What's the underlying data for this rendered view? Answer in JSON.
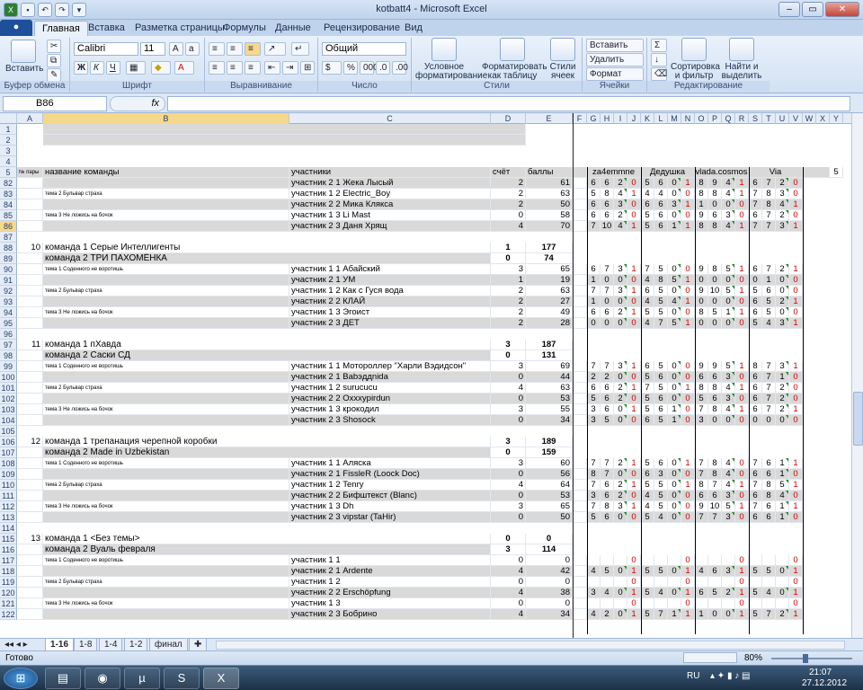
{
  "window": {
    "title": "kotbatt4 - Microsoft Excel"
  },
  "ribbon": {
    "tabs": [
      "Главная",
      "Вставка",
      "Разметка страницы",
      "Формулы",
      "Данные",
      "Рецензирование",
      "Вид"
    ],
    "paste": "Вставить",
    "clipboard": "Буфер обмена",
    "font_name": "Calibri",
    "font_size": "11",
    "font": "Шрифт",
    "alignment": "Выравнивание",
    "number_format": "Общий",
    "number": "Число",
    "cond_format_1": "Условное",
    "cond_format_2": "форматирование",
    "format_table_1": "Форматировать",
    "format_table_2": "как таблицу",
    "cell_styles_1": "Стили",
    "cell_styles_2": "ячеек",
    "styles": "Стили",
    "insert": "Вставить",
    "delete": "Удалить",
    "format": "Формат",
    "cells": "Ячейки",
    "sort_1": "Сортировка",
    "sort_2": "и фильтр",
    "find_1": "Найти и",
    "find_2": "выделить",
    "editing": "Редактирование"
  },
  "formula_bar": {
    "name_box": "B86",
    "fx": "fx",
    "value": ""
  },
  "columns": [
    "A",
    "B",
    "C",
    "D",
    "E",
    "F",
    "G",
    "H",
    "I",
    "J",
    "K",
    "L",
    "M",
    "N",
    "O",
    "P",
    "Q",
    "R",
    "S",
    "T",
    "U",
    "V",
    "W",
    "X",
    "Y"
  ],
  "selected_column": "B",
  "rows": [
    {
      "n": "1",
      "grey_b": true
    },
    {
      "n": "2",
      "grey_b": true
    },
    {
      "n": "3"
    },
    {
      "n": "4"
    },
    {
      "n": "5",
      "a": "№ пары",
      "b": "название команды",
      "c": "участники",
      "d": "счёт",
      "e": "баллы",
      "g": "za4emmne",
      "k": "Дедушка",
      "o": "vlada.cosmos",
      "s": "Via",
      "x": "5",
      "grey": true
    },
    {
      "n": "82",
      "b": "",
      "c": "участник 2 1 Жека Лысый",
      "d": "2",
      "e": "61",
      "s1": [
        "6",
        "6",
        "2",
        "0"
      ],
      "s2": [
        "5",
        "6",
        "0",
        "1"
      ],
      "s3": [
        "8",
        "9",
        "4",
        "1"
      ],
      "s4": [
        "6",
        "7",
        "2",
        "0"
      ],
      "grey": true
    },
    {
      "n": "83",
      "b": "тема 2 Бульвар страха",
      "c": "участник 1 2 Electric_Boy",
      "d": "2",
      "e": "63",
      "s1": [
        "5",
        "8",
        "4",
        "1"
      ],
      "s2": [
        "4",
        "4",
        "0",
        "0"
      ],
      "s3": [
        "8",
        "8",
        "4",
        "1"
      ],
      "s4": [
        "7",
        "8",
        "3",
        "0"
      ]
    },
    {
      "n": "84",
      "b": "",
      "c": "участник 2 2 Мика Клякса",
      "d": "2",
      "e": "50",
      "s1": [
        "6",
        "6",
        "3",
        "0"
      ],
      "s2": [
        "6",
        "6",
        "3",
        "1"
      ],
      "s3": [
        "1",
        "0",
        "0",
        "0"
      ],
      "s4": [
        "7",
        "8",
        "4",
        "1"
      ],
      "grey": true
    },
    {
      "n": "85",
      "b": "тема 3 Не ложись на бочок",
      "c": "участник 1 3 Li Mast",
      "d": "0",
      "e": "58",
      "s1": [
        "6",
        "6",
        "2",
        "0"
      ],
      "s2": [
        "5",
        "6",
        "0",
        "0"
      ],
      "s3": [
        "9",
        "6",
        "3",
        "0"
      ],
      "s4": [
        "6",
        "7",
        "2",
        "0"
      ]
    },
    {
      "n": "86",
      "b": "",
      "c": "участник 2 3 Даня Хрящ",
      "d": "4",
      "e": "70",
      "s1": [
        "7",
        "10",
        "4",
        "1"
      ],
      "s2": [
        "5",
        "6",
        "1",
        "1"
      ],
      "s3": [
        "8",
        "8",
        "4",
        "1"
      ],
      "s4": [
        "7",
        "7",
        "3",
        "1"
      ],
      "grey": true,
      "sel": true
    },
    {
      "n": "87"
    },
    {
      "n": "88",
      "a": "10",
      "b": "команда 1 Серые Интеллигенты",
      "d": "1",
      "e": "177",
      "team": true
    },
    {
      "n": "89",
      "b": "команда 2 ТРИ ПАХОМЁНКА",
      "d": "0",
      "e": "74",
      "team": true,
      "grey": true
    },
    {
      "n": "90",
      "b": "тема 1 Соденного не воротишь",
      "c": "участник 1 1 Абайский",
      "d": "3",
      "e": "65",
      "s1": [
        "6",
        "7",
        "3",
        "1"
      ],
      "s2": [
        "7",
        "5",
        "0",
        "0"
      ],
      "s3": [
        "9",
        "8",
        "5",
        "1"
      ],
      "s4": [
        "6",
        "7",
        "2",
        "1"
      ]
    },
    {
      "n": "91",
      "b": "",
      "c": "участник 2 1 УМ",
      "d": "1",
      "e": "19",
      "s1": [
        "1",
        "0",
        "0",
        "0"
      ],
      "s2": [
        "4",
        "8",
        "5",
        "1"
      ],
      "s3": [
        "0",
        "0",
        "0",
        "0"
      ],
      "s4": [
        "0",
        "1",
        "0",
        "0"
      ],
      "grey": true
    },
    {
      "n": "92",
      "b": "тема 2 Бульвар страха",
      "c": "участник 1 2 Как с Гуся вода",
      "d": "2",
      "e": "63",
      "s1": [
        "7",
        "7",
        "3",
        "1"
      ],
      "s2": [
        "6",
        "5",
        "0",
        "0"
      ],
      "s3": [
        "9",
        "10",
        "5",
        "1"
      ],
      "s4": [
        "5",
        "6",
        "0",
        "0"
      ]
    },
    {
      "n": "93",
      "b": "",
      "c": "участник 2 2 КЛАЙ",
      "d": "2",
      "e": "27",
      "s1": [
        "1",
        "0",
        "0",
        "0"
      ],
      "s2": [
        "4",
        "5",
        "4",
        "1"
      ],
      "s3": [
        "0",
        "0",
        "0",
        "0"
      ],
      "s4": [
        "6",
        "5",
        "2",
        "1"
      ],
      "grey": true
    },
    {
      "n": "94",
      "b": "тема 3 Не ложись на бочок",
      "c": "участник 1 3 Эгоист",
      "d": "2",
      "e": "49",
      "s1": [
        "6",
        "6",
        "2",
        "1"
      ],
      "s2": [
        "5",
        "5",
        "0",
        "0"
      ],
      "s3": [
        "8",
        "5",
        "1",
        "1"
      ],
      "s4": [
        "6",
        "5",
        "0",
        "0"
      ]
    },
    {
      "n": "95",
      "b": "",
      "c": "участник 2 3 ДЕТ",
      "d": "2",
      "e": "28",
      "s1": [
        "0",
        "0",
        "0",
        "0"
      ],
      "s2": [
        "4",
        "7",
        "5",
        "1"
      ],
      "s3": [
        "0",
        "0",
        "0",
        "0"
      ],
      "s4": [
        "5",
        "4",
        "3",
        "1"
      ],
      "grey": true
    },
    {
      "n": "96"
    },
    {
      "n": "97",
      "a": "11",
      "b": "команда 1 пХавда",
      "d": "3",
      "e": "187",
      "team": true
    },
    {
      "n": "98",
      "b": "команда 2 Саски СД",
      "d": "0",
      "e": "131",
      "team": true,
      "grey": true
    },
    {
      "n": "99",
      "b": "тема 1 Соденного не воротишь",
      "c": "участник 1 1 Мотороллер \"Харли Вэдидсон\"",
      "d": "3",
      "e": "69",
      "s1": [
        "7",
        "7",
        "3",
        "1"
      ],
      "s2": [
        "6",
        "5",
        "0",
        "0"
      ],
      "s3": [
        "9",
        "9",
        "5",
        "1"
      ],
      "s4": [
        "8",
        "7",
        "3",
        "1"
      ]
    },
    {
      "n": "100",
      "b": "",
      "c": "участник 2 1 Babэддnida",
      "d": "0",
      "e": "44",
      "s1": [
        "2",
        "2",
        "0",
        "0"
      ],
      "s2": [
        "5",
        "6",
        "0",
        "0"
      ],
      "s3": [
        "6",
        "6",
        "3",
        "0"
      ],
      "s4": [
        "6",
        "7",
        "1",
        "0"
      ],
      "grey": true
    },
    {
      "n": "101",
      "b": "тема 2 Бульвар страха",
      "c": "участник 1 2 surucucu",
      "d": "4",
      "e": "63",
      "s1": [
        "6",
        "6",
        "2",
        "1"
      ],
      "s2": [
        "7",
        "5",
        "0",
        "1"
      ],
      "s3": [
        "8",
        "8",
        "4",
        "1"
      ],
      "s4": [
        "6",
        "7",
        "2",
        "0"
      ]
    },
    {
      "n": "102",
      "b": "",
      "c": "участник 2 2 Oxxxypirdun",
      "d": "0",
      "e": "53",
      "s1": [
        "5",
        "6",
        "2",
        "0"
      ],
      "s2": [
        "5",
        "6",
        "0",
        "0"
      ],
      "s3": [
        "5",
        "6",
        "3",
        "0"
      ],
      "s4": [
        "6",
        "7",
        "2",
        "0"
      ],
      "grey": true
    },
    {
      "n": "103",
      "b": "тема 3 Не ложись на бочок",
      "c": "участник 1 3 крокодил",
      "d": "3",
      "e": "55",
      "s1": [
        "3",
        "6",
        "0",
        "1"
      ],
      "s2": [
        "5",
        "6",
        "1",
        "0"
      ],
      "s3": [
        "7",
        "8",
        "4",
        "1"
      ],
      "s4": [
        "6",
        "7",
        "2",
        "1"
      ]
    },
    {
      "n": "104",
      "b": "",
      "c": "участник 2 3 Shosock",
      "d": "0",
      "e": "34",
      "s1": [
        "3",
        "5",
        "0",
        "0"
      ],
      "s2": [
        "6",
        "5",
        "1",
        "0"
      ],
      "s3": [
        "3",
        "0",
        "0",
        "0"
      ],
      "s4": [
        "0",
        "0",
        "0",
        "0"
      ],
      "grey": true
    },
    {
      "n": "105"
    },
    {
      "n": "106",
      "a": "12",
      "b": "команда 1 трепанация черепной коробки",
      "d": "3",
      "e": "189",
      "team": true
    },
    {
      "n": "107",
      "b": "команда 2 Made in Uzbekistan",
      "d": "0",
      "e": "159",
      "team": true,
      "grey": true
    },
    {
      "n": "108",
      "b": "тема 1 Соденного не воротишь",
      "c": "участник 1 1 Аляска",
      "d": "3",
      "e": "60",
      "s1": [
        "7",
        "7",
        "2",
        "1"
      ],
      "s2": [
        "5",
        "6",
        "0",
        "1"
      ],
      "s3": [
        "7",
        "8",
        "4",
        "0"
      ],
      "s4": [
        "7",
        "6",
        "1",
        "1"
      ]
    },
    {
      "n": "109",
      "b": "",
      "c": "участник 2 1 FissleR (Loock Doc)",
      "d": "0",
      "e": "56",
      "s1": [
        "8",
        "7",
        "0",
        "0"
      ],
      "s2": [
        "6",
        "3",
        "0",
        "0"
      ],
      "s3": [
        "7",
        "8",
        "4",
        "0"
      ],
      "s4": [
        "6",
        "6",
        "1",
        "0"
      ],
      "grey": true
    },
    {
      "n": "110",
      "b": "тема 2 Бульвар страха",
      "c": "участник 1 2 Tenry",
      "d": "4",
      "e": "64",
      "s1": [
        "7",
        "6",
        "2",
        "1"
      ],
      "s2": [
        "5",
        "5",
        "0",
        "1"
      ],
      "s3": [
        "8",
        "7",
        "4",
        "1"
      ],
      "s4": [
        "7",
        "8",
        "5",
        "1"
      ]
    },
    {
      "n": "111",
      "b": "",
      "c": "участник 2 2 Бифштекст (Blanc)",
      "d": "0",
      "e": "53",
      "s1": [
        "3",
        "6",
        "2",
        "0"
      ],
      "s2": [
        "4",
        "5",
        "0",
        "0"
      ],
      "s3": [
        "6",
        "6",
        "3",
        "0"
      ],
      "s4": [
        "6",
        "8",
        "4",
        "0"
      ],
      "grey": true
    },
    {
      "n": "112",
      "b": "тема 3 Не ложись на бочок",
      "c": "участник 1 3 Dh",
      "d": "3",
      "e": "65",
      "s1": [
        "7",
        "8",
        "3",
        "1"
      ],
      "s2": [
        "4",
        "5",
        "0",
        "0"
      ],
      "s3": [
        "9",
        "10",
        "5",
        "1"
      ],
      "s4": [
        "7",
        "6",
        "1",
        "1"
      ]
    },
    {
      "n": "113",
      "b": "",
      "c": "участник 2 3 vipstar (TaHir)",
      "d": "0",
      "e": "50",
      "s1": [
        "5",
        "6",
        "0",
        "0"
      ],
      "s2": [
        "5",
        "4",
        "0",
        "0"
      ],
      "s3": [
        "7",
        "7",
        "3",
        "0"
      ],
      "s4": [
        "6",
        "6",
        "1",
        "0"
      ],
      "grey": true
    },
    {
      "n": "114"
    },
    {
      "n": "115",
      "a": "13",
      "b": "команда 1 <Без темы>",
      "d": "0",
      "e": "0",
      "team": true
    },
    {
      "n": "116",
      "b": "команда 2 Вуаль февраля",
      "d": "3",
      "e": "114",
      "team": true,
      "grey": true
    },
    {
      "n": "117",
      "b": "тема 1 Соденного не воротишь",
      "c": "участник 1 1",
      "d": "0",
      "e": "0",
      "s1": [
        "",
        "",
        "",
        "0"
      ],
      "s2": [
        "",
        "",
        "",
        "0"
      ],
      "s3": [
        "",
        "",
        "",
        "0"
      ],
      "s4": [
        "",
        "",
        "",
        "0"
      ]
    },
    {
      "n": "118",
      "b": "",
      "c": "участник 2 1 Ardente",
      "d": "4",
      "e": "42",
      "s1": [
        "4",
        "5",
        "0",
        "1"
      ],
      "s2": [
        "5",
        "5",
        "0",
        "1"
      ],
      "s3": [
        "4",
        "6",
        "3",
        "1"
      ],
      "s4": [
        "5",
        "5",
        "0",
        "1"
      ],
      "grey": true
    },
    {
      "n": "119",
      "b": "тема 2 Бульвар страха",
      "c": "участник 1 2",
      "d": "0",
      "e": "0",
      "s1": [
        "",
        "",
        "",
        "0"
      ],
      "s2": [
        "",
        "",
        "",
        "0"
      ],
      "s3": [
        "",
        "",
        "",
        "0"
      ],
      "s4": [
        "",
        "",
        "",
        "0"
      ]
    },
    {
      "n": "120",
      "b": "",
      "c": "участник 2 2 Erschöpfung",
      "d": "4",
      "e": "38",
      "s1": [
        "3",
        "4",
        "0",
        "1"
      ],
      "s2": [
        "5",
        "4",
        "0",
        "1"
      ],
      "s3": [
        "6",
        "5",
        "2",
        "1"
      ],
      "s4": [
        "5",
        "4",
        "0",
        "1"
      ],
      "grey": true
    },
    {
      "n": "121",
      "b": "тема 3 Не ложись на бочок",
      "c": "участник 1 3",
      "d": "0",
      "e": "0",
      "s1": [
        "",
        "",
        "",
        "0"
      ],
      "s2": [
        "",
        "",
        "",
        "0"
      ],
      "s3": [
        "",
        "",
        "",
        "0"
      ],
      "s4": [
        "",
        "",
        "",
        "0"
      ]
    },
    {
      "n": "122",
      "b": "",
      "c": "участник 2 3 Бобрино",
      "d": "4",
      "e": "34",
      "s1": [
        "4",
        "2",
        "0",
        "1"
      ],
      "s2": [
        "5",
        "7",
        "1",
        "1"
      ],
      "s3": [
        "1",
        "0",
        "0",
        "1"
      ],
      "s4": [
        "5",
        "7",
        "2",
        "1"
      ],
      "grey": true
    }
  ],
  "sheet_tabs": [
    "1-16",
    "1-8",
    "1-4",
    "1-2",
    "финал"
  ],
  "active_sheet": "1-16",
  "status": {
    "ready": "Готово",
    "zoom": "80%"
  },
  "taskbar": {
    "lang": "RU",
    "time": "21:07",
    "date": "27.12.2012"
  }
}
